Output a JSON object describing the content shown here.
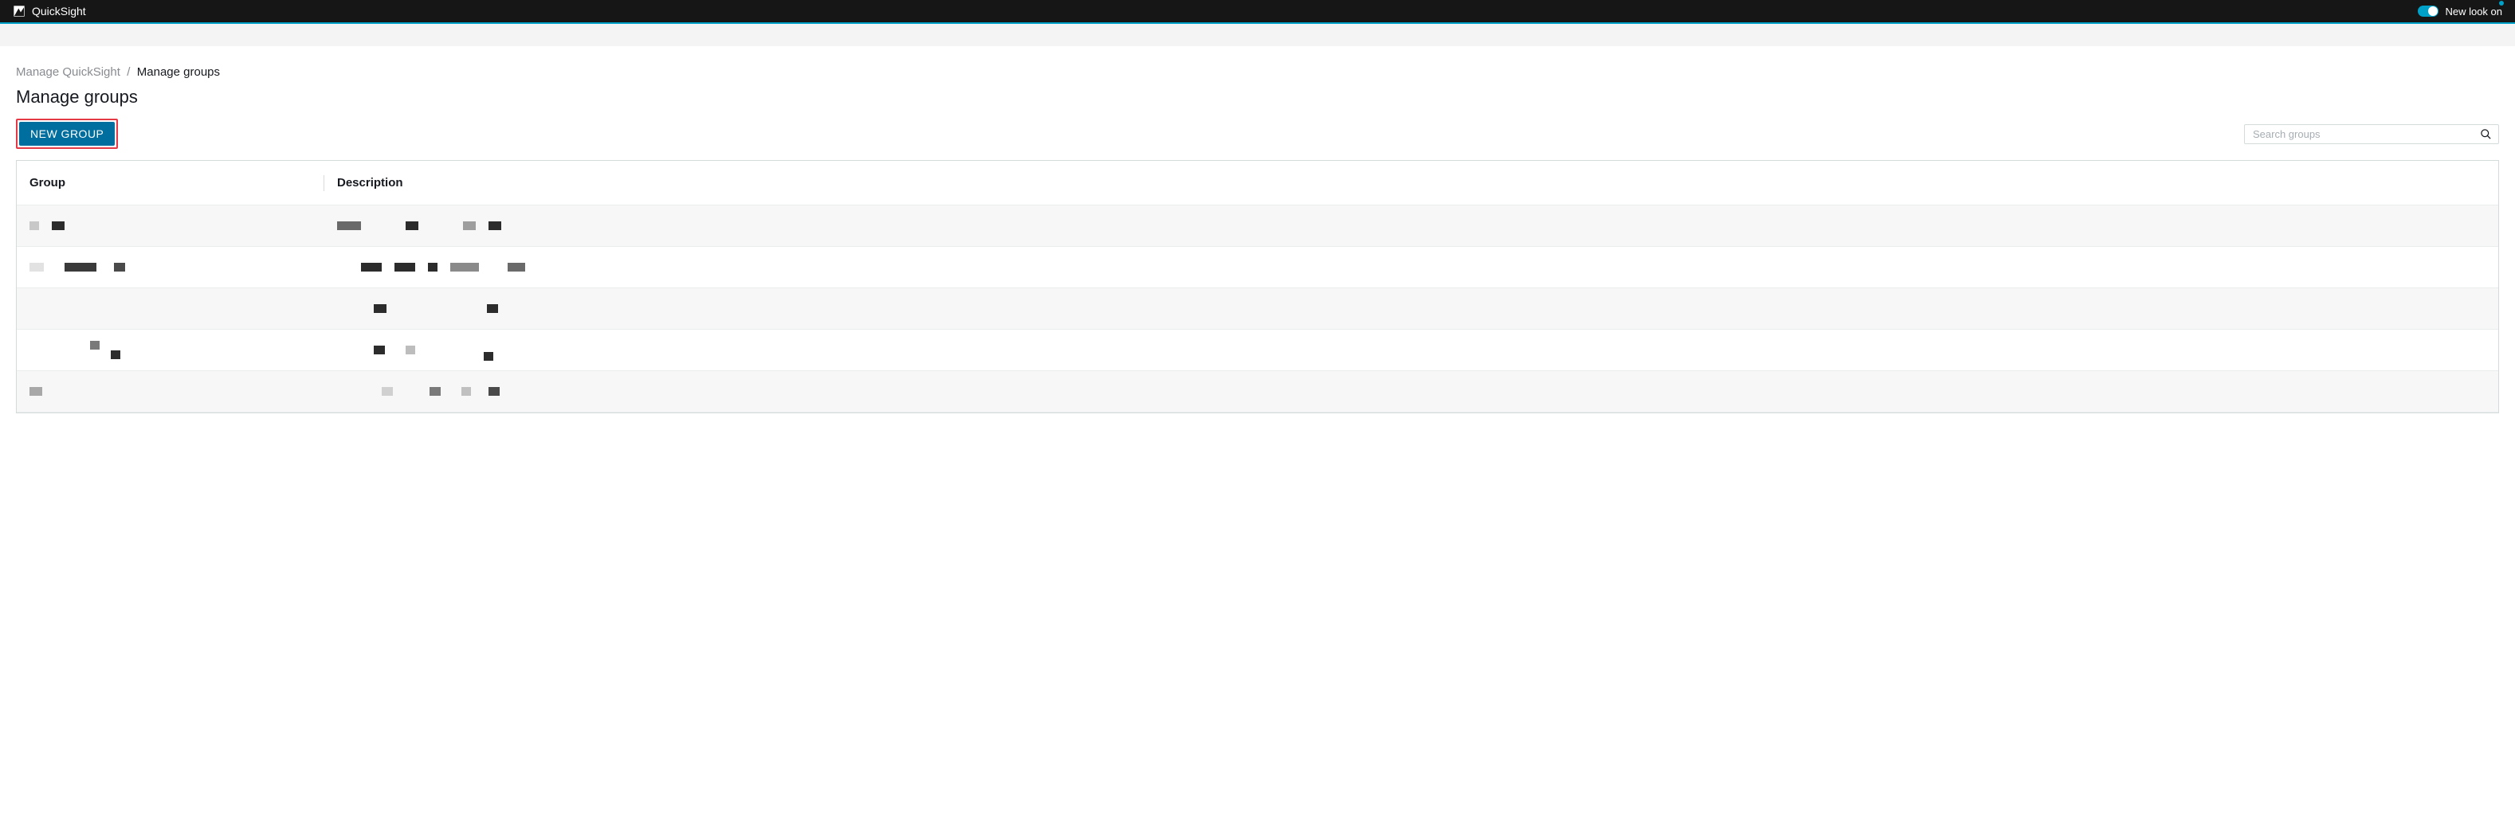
{
  "topbar": {
    "app_name": "QuickSight",
    "toggle_label": "New look on"
  },
  "breadcrumb": {
    "parent": "Manage QuickSight",
    "sep": "/",
    "current": "Manage groups"
  },
  "page_title": "Manage groups",
  "actions": {
    "new_group_label": "NEW GROUP"
  },
  "search": {
    "placeholder": "Search groups"
  },
  "table": {
    "columns": {
      "group": "Group",
      "description": "Description"
    },
    "rows": [
      {
        "group_redact": [
          {
            "w": 12,
            "c": "#c8c8c8"
          },
          {
            "w": 16,
            "c": "#2c2c2c"
          }
        ],
        "desc_redact": [
          {
            "w": 30,
            "c": "#6a6a6a"
          },
          {
            "w": 16,
            "c": "#2c2c2c",
            "ml": 40
          },
          {
            "w": 16,
            "c": "#9e9e9e",
            "ml": 40
          },
          {
            "w": 16,
            "c": "#2c2c2c"
          }
        ],
        "alt": true
      },
      {
        "group_redact": [
          {
            "w": 18,
            "c": "#e2e2e2"
          },
          {
            "w": 40,
            "c": "#3a3a3a",
            "ml": 10
          },
          {
            "w": 14,
            "c": "#4a4a4a",
            "ml": 6
          }
        ],
        "desc_redact": [
          {
            "w": 26,
            "c": "#2c2c2c",
            "ml": 30
          },
          {
            "w": 26,
            "c": "#2c2c2c"
          },
          {
            "w": 12,
            "c": "#2c2c2c"
          },
          {
            "w": 36,
            "c": "#8a8a8a"
          },
          {
            "w": 22,
            "c": "#6a6a6a",
            "ml": 20
          }
        ],
        "alt": false
      },
      {
        "group_redact": [],
        "desc_redact": [
          {
            "w": 16,
            "c": "#2c2c2c",
            "ml": 46
          },
          {
            "w": 14,
            "c": "#2c2c2c",
            "ml": 110
          }
        ],
        "alt": true
      },
      {
        "group_redact": [
          {
            "w": 12,
            "c": "#7a7a7a",
            "ml": 76,
            "mt": -6
          },
          {
            "w": 12,
            "c": "#2c2c2c",
            "ml": -2,
            "mt": 6
          }
        ],
        "desc_redact": [
          {
            "w": 14,
            "c": "#2c2c2c",
            "ml": 46
          },
          {
            "w": 12,
            "c": "#bdbdbd",
            "ml": 10
          },
          {
            "w": 12,
            "c": "#2c2c2c",
            "ml": 70,
            "mt": 8
          }
        ],
        "alt": false
      },
      {
        "group_redact": [
          {
            "w": 16,
            "c": "#a8a8a8"
          }
        ],
        "desc_redact": [
          {
            "w": 14,
            "c": "#d0d0d0",
            "ml": 56
          },
          {
            "w": 14,
            "c": "#7a7a7a",
            "ml": 30
          },
          {
            "w": 12,
            "c": "#c0c0c0",
            "ml": 10
          },
          {
            "w": 14,
            "c": "#4a4a4a",
            "ml": 6
          }
        ],
        "alt": true
      }
    ]
  }
}
